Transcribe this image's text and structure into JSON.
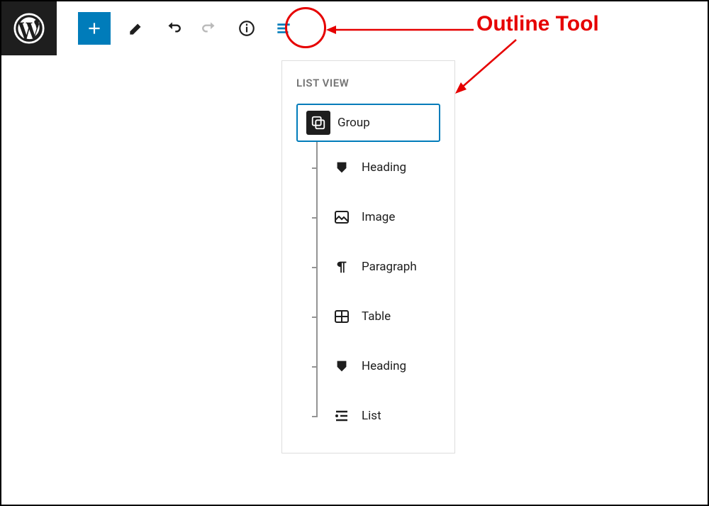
{
  "annotation": {
    "label": "Outline Tool"
  },
  "listView": {
    "title": "LIST VIEW",
    "root": {
      "label": "Group",
      "icon": "group"
    },
    "children": [
      {
        "label": "Heading",
        "icon": "heading"
      },
      {
        "label": "Image",
        "icon": "image"
      },
      {
        "label": "Paragraph",
        "icon": "paragraph"
      },
      {
        "label": "Table",
        "icon": "table"
      },
      {
        "label": "Heading",
        "icon": "heading"
      },
      {
        "label": "List",
        "icon": "list"
      }
    ]
  },
  "toolbar": {
    "buttons": [
      "add",
      "edit",
      "undo",
      "redo",
      "info",
      "outline"
    ]
  }
}
